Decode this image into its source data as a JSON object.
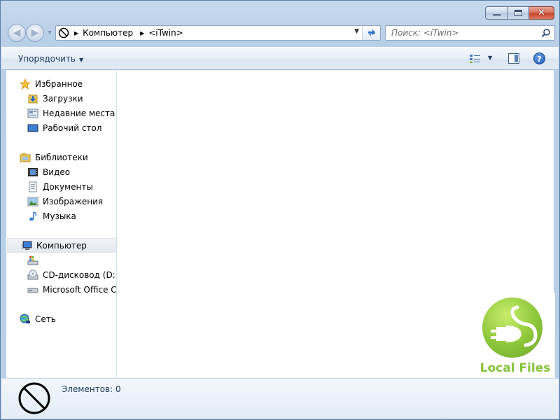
{
  "window": {
    "minimize_glyph": "–",
    "maximize_glyph": "□",
    "close_glyph": "✕"
  },
  "navigation": {
    "back_arrow": "◀",
    "forward_arrow": "▶"
  },
  "address_bar": {
    "crumbs": [
      "Компьютер",
      "<iTwin>"
    ]
  },
  "search": {
    "placeholder": "Поиск: <iTwin>"
  },
  "command_bar": {
    "organize_label": "Упорядочить",
    "help_label": "?"
  },
  "sidebar": {
    "favorites": {
      "label": "Избранное",
      "items": [
        {
          "label": "Загрузки",
          "icon": "downloads-folder-icon"
        },
        {
          "label": "Недавние места",
          "icon": "recent-places-icon"
        },
        {
          "label": "Рабочий стол",
          "icon": "desktop-icon"
        }
      ]
    },
    "libraries": {
      "label": "Библиотеки",
      "items": [
        {
          "label": "Видео",
          "icon": "video-icon"
        },
        {
          "label": "Документы",
          "icon": "documents-icon"
        },
        {
          "label": "Изображения",
          "icon": "pictures-icon"
        },
        {
          "label": "Музыка",
          "icon": "music-icon"
        }
      ]
    },
    "computer": {
      "label": "Компьютер",
      "items": [
        {
          "label": "",
          "icon": "local-disk-icon"
        },
        {
          "label": "CD-дисковод (D:) iTwin",
          "icon": "cd-drive-icon"
        },
        {
          "label": "Microsoft Office Click-to-Run",
          "icon": "drive-icon"
        }
      ]
    },
    "network": {
      "label": "Сеть"
    }
  },
  "logo": {
    "text": "Local Files",
    "color": "#86c23a"
  },
  "details": {
    "count_text": "Элементов: 0"
  }
}
